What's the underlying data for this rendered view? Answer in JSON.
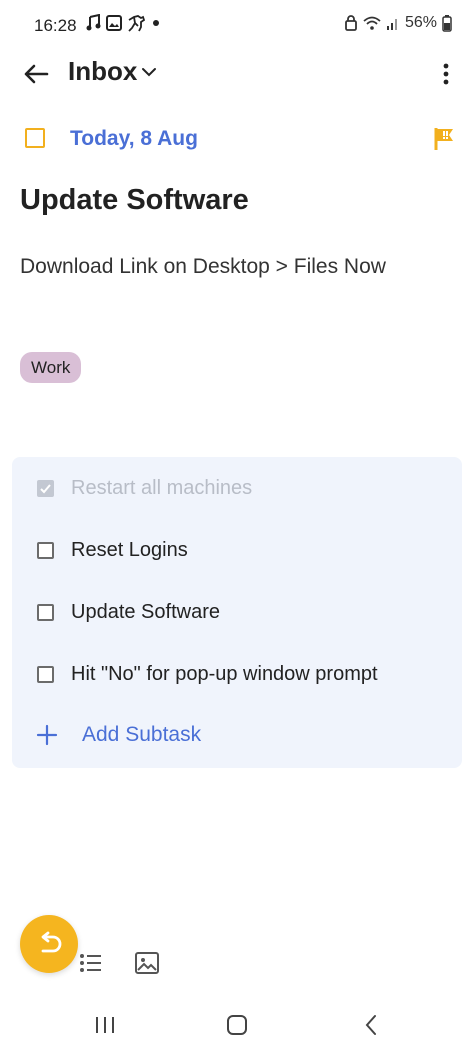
{
  "status_bar": {
    "time": "16:28",
    "battery": "56%",
    "left_icons": [
      "music-note-icon",
      "gallery-icon",
      "horse-icon",
      "dot-icon"
    ],
    "right_icons": [
      "lock-icon",
      "wifi-icon",
      "signal-icon",
      "battery-icon"
    ]
  },
  "app_bar": {
    "title": "Inbox"
  },
  "task": {
    "due_date": "Today, 8 Aug",
    "title": "Update Software",
    "description": "Download Link on Desktop > Files Now",
    "tag": "Work",
    "priority_color": "#f2b01e"
  },
  "subtasks": {
    "items": [
      {
        "label": "Restart all machines",
        "done": true
      },
      {
        "label": "Reset Logins",
        "done": false
      },
      {
        "label": "Update Software",
        "done": false
      },
      {
        "label": "Hit \"No\" for pop-up window prompt",
        "done": false
      }
    ],
    "add_label": "Add Subtask"
  },
  "colors": {
    "accent_blue": "#4a6fd6",
    "accent_yellow": "#f5b51f",
    "tag_bg": "#d9bfd6",
    "panel_bg": "#f0f4fc"
  }
}
